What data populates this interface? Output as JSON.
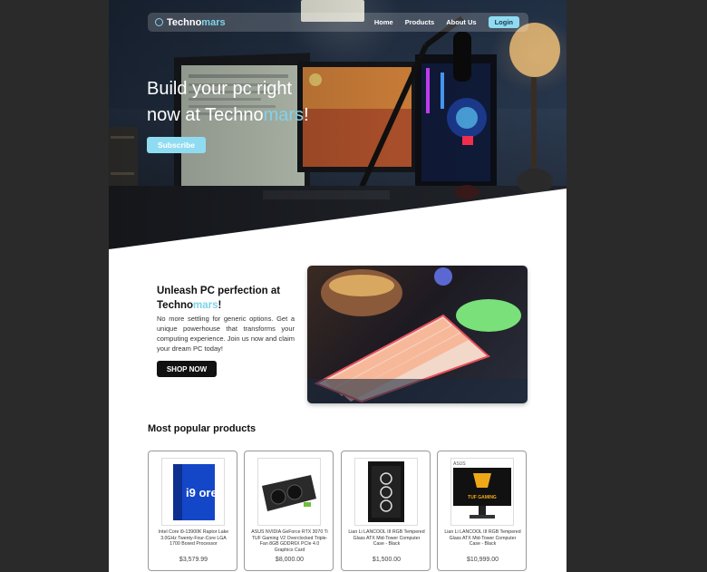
{
  "nav": {
    "brand_main": "Techno",
    "brand_accent": "mars",
    "links": [
      "Home",
      "Products",
      "About Us"
    ],
    "login_label": "Login"
  },
  "hero": {
    "line1": "Build your pc right",
    "line2_prefix": "now at Techno",
    "line2_accent": "mars",
    "line2_suffix": "!",
    "subscribe_label": "Subscribe"
  },
  "promo": {
    "title_line1": "Unleash PC perfection at",
    "title_brand": "Techno",
    "title_accent": "mars",
    "title_suffix": "!",
    "body": "No more settling for generic options. Get a unique powerhouse that transforms your computing experience. Join us now and claim your dream PC today!",
    "button_label": "SHOP NOW"
  },
  "products": {
    "heading": "Most popular products",
    "items": [
      {
        "name": "Intel Core i9-13900K Raptor Lake 3.0GHz Twenty-Four-Core LGA 1700 Boxed Processor",
        "price": "$3,579.99"
      },
      {
        "name": "ASUS NVIDIA GeForce RTX 3070 Ti TUF Gaming V2 Overclocked Triple-Fan 8GB GDDR6X PCIe 4.0 Graphics Card",
        "price": "$8,000.00"
      },
      {
        "name": "Lian Li LANCOOL III RGB Tempered Glass ATX Mid-Tower Computer Case - Black",
        "price": "$1,500.00"
      },
      {
        "name": "Lian Li LANCOOL III RGB Tempered Glass ATX Mid-Tower Computer Case - Black",
        "price": "$10,999.00"
      }
    ]
  },
  "product_images": {
    "cpu_box_text": "i9 ore",
    "monitor_text": "TUF GAMING",
    "monitor_brand": "ASUS"
  },
  "colors": {
    "accent": "#7fd3ea",
    "button_light": "#8fdcf2",
    "dark": "#111111"
  }
}
